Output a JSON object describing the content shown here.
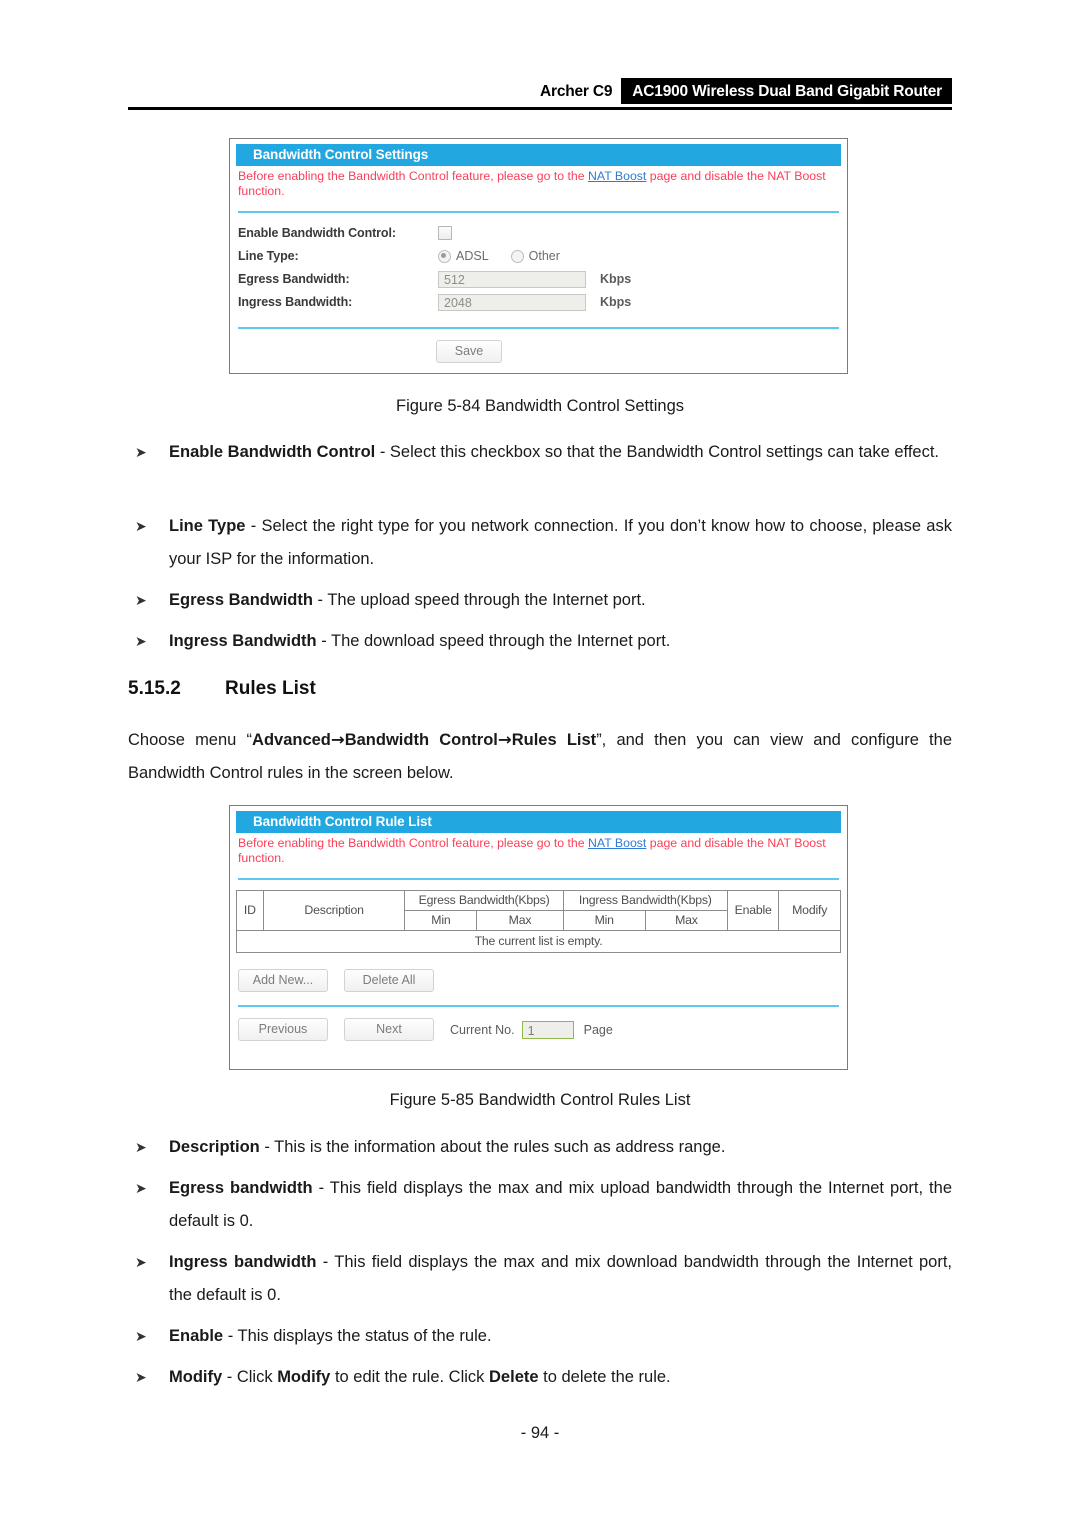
{
  "header": {
    "model": "Archer C9",
    "product": "AC1900 Wireless Dual Band Gigabit Router"
  },
  "figure_settings": {
    "title": "Bandwidth Control Settings",
    "warning_pre": "Before enabling the Bandwidth Control feature, please go to the ",
    "warning_link": "NAT Boost",
    "warning_post": " page and disable the NAT Boost function.",
    "fields": {
      "enable_label": "Enable Bandwidth Control:",
      "line_type_label": "Line Type:",
      "line_type_option_1": "ADSL",
      "line_type_option_2": "Other",
      "egress_label": "Egress Bandwidth:",
      "egress_value": "512",
      "egress_unit": "Kbps",
      "ingress_label": "Ingress Bandwidth:",
      "ingress_value": "2048",
      "ingress_unit": "Kbps"
    },
    "save_button": "Save",
    "caption": "Figure 5-84 Bandwidth Control Settings"
  },
  "figure_rule_list": {
    "title": "Bandwidth Control Rule List",
    "warning_pre": "Before enabling the Bandwidth Control feature, please go to the ",
    "warning_link": "NAT Boost",
    "warning_post": " page and disable the NAT Boost function.",
    "table": {
      "headers": {
        "id": "ID",
        "description": "Description",
        "egress_group": "Egress Bandwidth(Kbps)",
        "ingress_group": "Ingress Bandwidth(Kbps)",
        "enable": "Enable",
        "modify": "Modify",
        "egress_min": "Min",
        "egress_max": "Max",
        "ingress_min": "Min",
        "ingress_max": "Max"
      },
      "empty_message": "The current list is empty.",
      "rows": []
    },
    "buttons": {
      "add_new": "Add New...",
      "delete_all": "Delete All",
      "previous": "Previous",
      "next": "Next"
    },
    "pager": {
      "current_no_label": "Current No.",
      "current_no_value": "1",
      "page_label": "Page"
    },
    "caption": "Figure 5-85 Bandwidth Control Rules List"
  },
  "bullets_top": [
    {
      "marker": "➤",
      "term": "Enable Bandwidth Control",
      "sep": " - ",
      "body": "Select this checkbox so that the Bandwidth Control settings can take effect."
    },
    {
      "marker": "➤",
      "term": "Line Type",
      "sep": " - ",
      "body": "Select the right type for you network connection. If you don’t know how to choose, please ask your ISP for the information."
    },
    {
      "marker": "➤",
      "term": "Egress Bandwidth",
      "sep": " - ",
      "body": "The upload speed through the Internet port."
    },
    {
      "marker": "➤",
      "term": "Ingress Bandwidth",
      "sep": " - ",
      "body": "The download speed through the Internet port."
    }
  ],
  "section": {
    "number": "5.15.2",
    "title": "Rules List",
    "intro_pre": "Choose menu “",
    "intro_menu_1": "Advanced",
    "intro_arrow_1": "→",
    "intro_menu_2": "Bandwidth Control",
    "intro_arrow_2": "→",
    "intro_menu_3": "Rules List",
    "intro_post": "”, and then you can view and configure the Bandwidth Control rules in the screen below."
  },
  "bullets_bottom": [
    {
      "marker": "➤",
      "term": "Description",
      "sep": " - ",
      "body": "This is the information about the rules such as address range."
    },
    {
      "marker": "➤",
      "term": "Egress bandwidth",
      "sep": " - ",
      "body": "This field displays the max and mix upload bandwidth through the Internet port, the default is 0."
    },
    {
      "marker": "➤",
      "term": "Ingress bandwidth",
      "sep": " - ",
      "body": "This field displays the max and mix download bandwidth through the Internet port, the default is 0."
    },
    {
      "marker": "➤",
      "term": "Enable",
      "sep": " - ",
      "body": "This displays the status of the rule."
    }
  ],
  "bullet_modify": {
    "marker": "➤",
    "term": "Modify",
    "sep": " - ",
    "body_1": "Click ",
    "emph_1": "Modify",
    "body_2": " to edit the rule. Click ",
    "emph_2": "Delete",
    "body_3": " to delete the rule."
  },
  "footer": {
    "page_number": "- 94 -"
  },
  "colors": {
    "titlebar": "#22a7e0",
    "warning": "#fb3e59",
    "link": "#2f7bd4",
    "divider": "#5ec8ef",
    "page_input_border": "#8fba4a"
  }
}
